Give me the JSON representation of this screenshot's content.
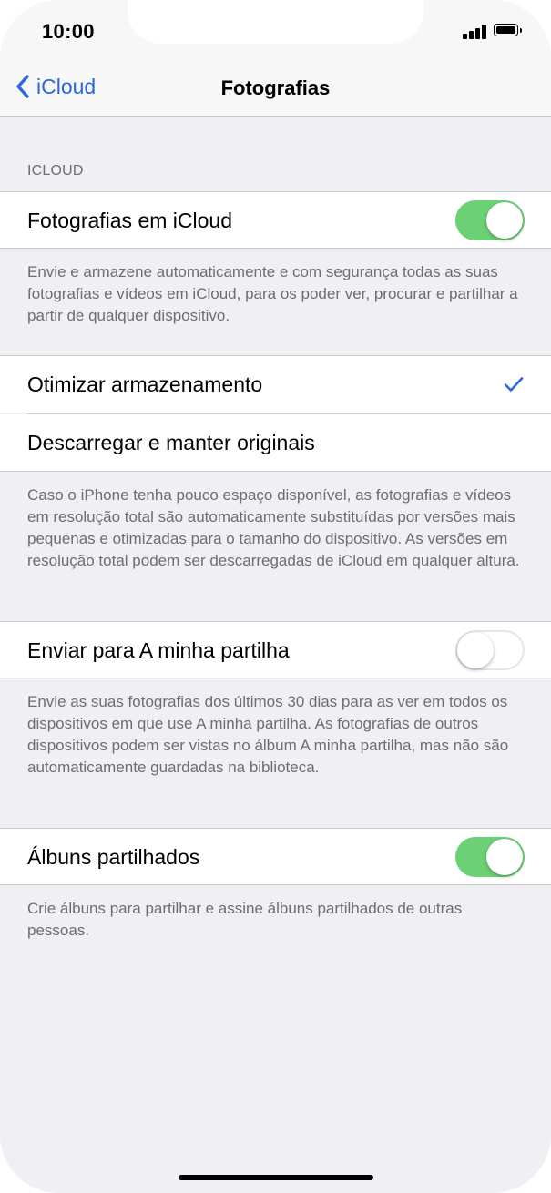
{
  "status": {
    "time": "10:00"
  },
  "nav": {
    "back_label": "iCloud",
    "title": "Fotografias"
  },
  "section": {
    "header": "ICLOUD"
  },
  "rows": {
    "icloud_photos": {
      "label": "Fotografias em iCloud",
      "toggle": "on"
    },
    "icloud_photos_footer": "Envie e armazene automaticamente e com segurança todas as suas fotografias e vídeos em iCloud, para os poder ver, procurar e partilhar a partir de qualquer dispositivo.",
    "optimize": {
      "label": "Otimizar armazenamento",
      "selected": true
    },
    "download": {
      "label": "Descarregar e manter originais",
      "selected": false
    },
    "storage_footer": "Caso o iPhone tenha pouco espaço disponível, as fotografias e vídeos em resolução total são automaticamente substituídas por versões mais pequenas e otimizadas para o tamanho do dispositivo. As versões em resolução total podem ser descarregadas de iCloud em qualquer altura.",
    "my_stream": {
      "label": "Enviar para A minha partilha",
      "toggle": "off"
    },
    "my_stream_footer": "Envie as suas fotografias dos últimos 30 dias para as ver em todos os dispositivos em que use A minha partilha. As fotografias de outros dispositivos podem ser vistas no álbum A minha partilha, mas não são automaticamente guardadas na biblioteca.",
    "shared_albums": {
      "label": "Álbuns partilhados",
      "toggle": "on"
    },
    "shared_albums_footer": "Crie álbuns para partilhar e assine álbuns partilhados de outras pessoas."
  },
  "colors": {
    "accent": "#2968d8",
    "toggle_on": "#6cd174",
    "background": "#efeff4",
    "footer_text": "#6d6d72"
  },
  "icons": [
    "chevron-left-icon",
    "signal-icon",
    "battery-icon",
    "checkmark-icon"
  ]
}
